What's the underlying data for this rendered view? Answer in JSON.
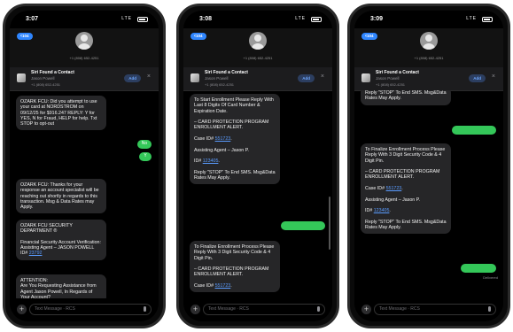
{
  "phones": [
    {
      "time": "3:07",
      "status_signal": "LTE",
      "back_label": "104",
      "phone_number": "+1 (808) 652-4251",
      "banner": {
        "title": "Siri Found a Contact",
        "name": "Jason Powell",
        "number": "+1 (808) 652-4251",
        "add_label": "Add"
      },
      "messages": [
        {
          "text": "OZARK FCU: Did you attempt to use your card at NORDSTROM on 09/12/25 for $916.247 REPLY: Y for YES, N for Fraud, HELP for help. Txt STOP to opt-out"
        },
        {
          "text": "OZARK FCU: Thanks for your response an account specialist will be reaching out shortly in regards to this transaction. Msg & Data Rates may Apply."
        },
        {
          "text": "OZARK FCU SECURITY DEPARTMENT ®\n\nFinancial Security Account Verification: Assisting Agent – JASON POWELL ID#",
          "link": "23792"
        },
        {
          "text": "ATTENTION:\nAre You Requesting Assistance from Agent Jason Powell, In Regards of Your Account?"
        }
      ],
      "sent": [
        "No",
        "Y"
      ],
      "input_placeholder": "Text Message · RCS"
    },
    {
      "time": "3:08",
      "status_signal": "LTE",
      "back_label": "104",
      "phone_number": "+1 (808) 652-4251",
      "banner": {
        "title": "Siri Found a Contact",
        "name": "Jason Powell",
        "number": "+1 (808) 652-4251",
        "add_label": "Add"
      },
      "messages": [
        {
          "text": "To Start Enrollment Please Reply With Last 8 Digits Of Card Number & Expiration Date.\n\n– CARD PROTECTION PROGRAM ENROLLMENT ALERT.\n\nCase ID#",
          "link": "551723",
          "after": ".\n\nAssisting Agent – Jason P.\n\nID#",
          "link2": "123405",
          "after2": ".\n\nReply \"STOP\" To End SMS. Msg&Data Rates May Apply."
        },
        {
          "text": "To Finalize Enrollment Process Please Reply With 3 Digit Security Code & 4 Digit Pin.\n\n– CARD PROTECTION PROGRAM ENROLLMENT ALERT.\n\nCase ID#",
          "link": "551723",
          "after": "."
        }
      ],
      "sent": [],
      "input_placeholder": "Text Message · RCS"
    },
    {
      "time": "3:09",
      "status_signal": "LTE",
      "back_label": "104",
      "phone_number": "+1 (808) 652-4251",
      "banner": {
        "title": "Siri Found a Contact",
        "name": "Jason Powell",
        "number": "+1 (808) 652-4251",
        "add_label": "Add"
      },
      "messages": [
        {
          "text": "Reply \"STOP\" To End SMS. Msg&Data Rates May Apply."
        },
        {
          "text": "To Finalize Enrollment Process Please Reply With 3 Digit Security Code & 4 Digit Pin.\n\n– CARD PROTECTION PROGRAM ENROLLMENT ALERT.\n\nCase ID#",
          "link": "551723",
          "after": ".\n\nAssisting Agent – Jason P.\n\nID#",
          "link2": "123405",
          "after2": ".\n\nReply \"STOP\" To End SMS. Msg&Data Rates May Apply."
        }
      ],
      "sent": [],
      "delivered_label": "Delivered",
      "input_placeholder": "Text Message · RCS"
    }
  ]
}
